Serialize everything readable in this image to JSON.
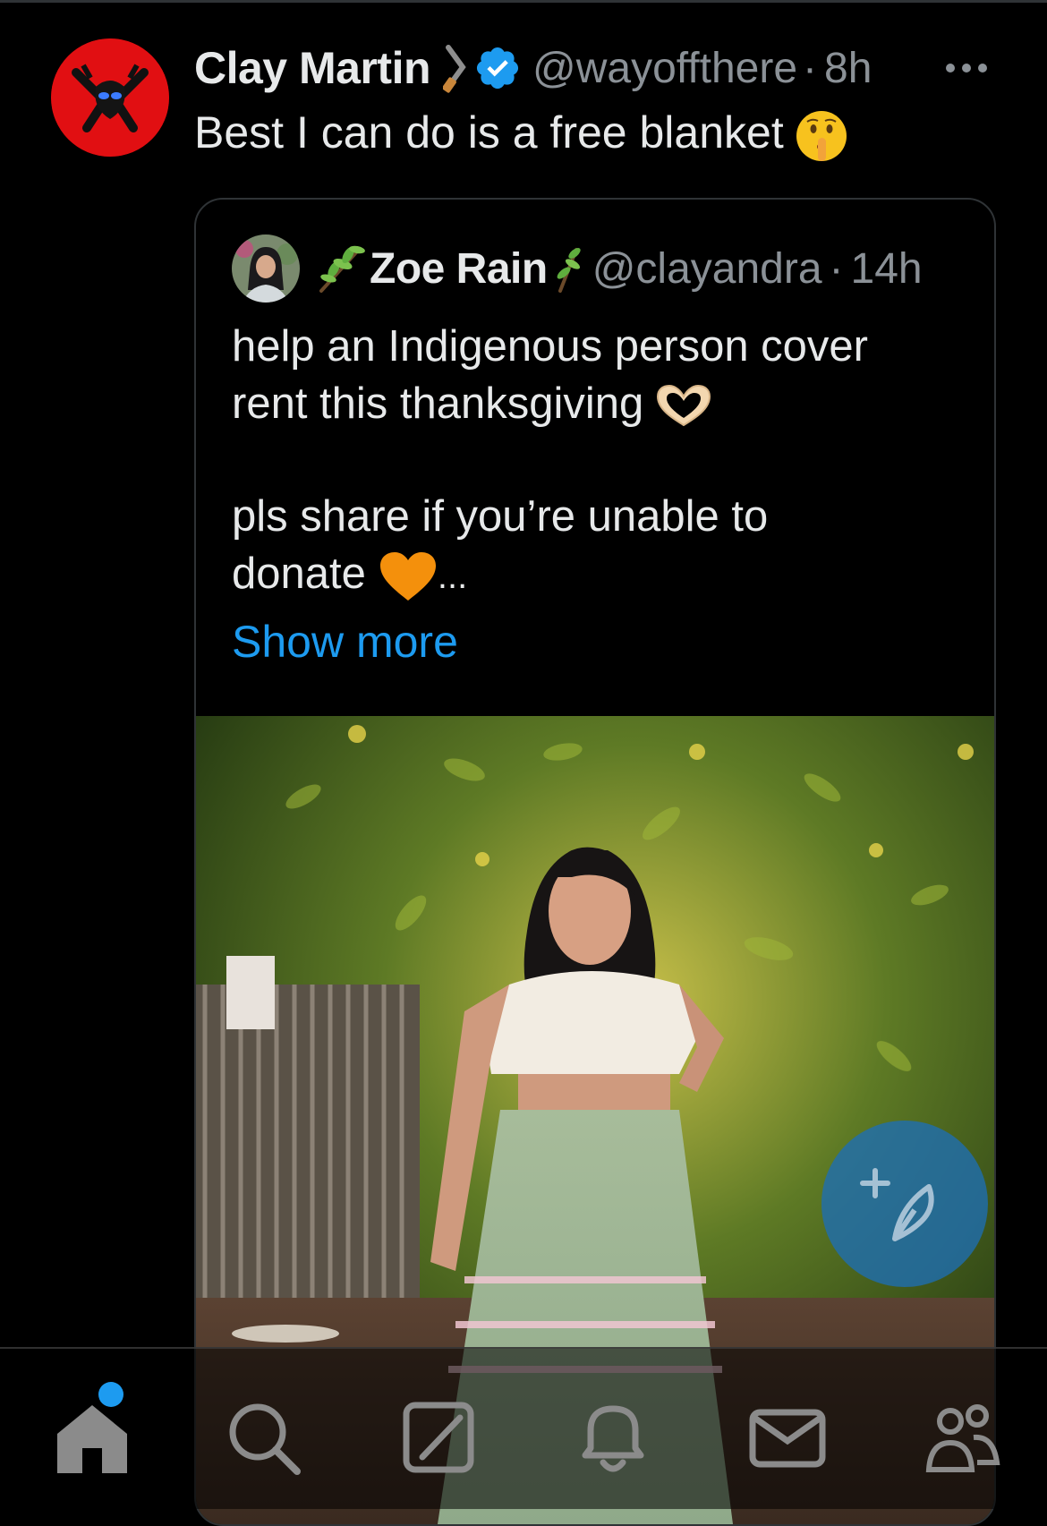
{
  "tweet": {
    "author_name": "Clay Martin",
    "handle": "@wayoffthere",
    "separator": "·",
    "time": "8h",
    "text": "Best I can do is a free blanket",
    "icons": [
      "sword-icon",
      "verified-badge-icon",
      "shushing-face-emoji",
      "more-options-icon"
    ]
  },
  "quote": {
    "author_name": "Zoe Rain",
    "handle": "@clayandra",
    "separator": "·",
    "time": "14h",
    "line1": "help an Indigenous person cover",
    "line2": "rent this thanksgiving",
    "line3": "pls share if you’re unable to",
    "line4_text": "donate",
    "ellipsis": "...",
    "show_more": "Show more",
    "icons": [
      "herb-icon",
      "heart-hands-emoji",
      "orange-heart-emoji"
    ]
  },
  "colors": {
    "background": "#000000",
    "text": "#e7e9ea",
    "secondary_text": "#8b9197",
    "link": "#1d9bf0",
    "verified": "#1d9bf0",
    "border": "#2f3336"
  },
  "bottom_nav": {
    "items": [
      "home-icon",
      "search-icon",
      "grok-icon",
      "notifications-icon",
      "messages-icon",
      "communities-icon"
    ],
    "active": "home-icon",
    "home_has_new_dot": true
  }
}
